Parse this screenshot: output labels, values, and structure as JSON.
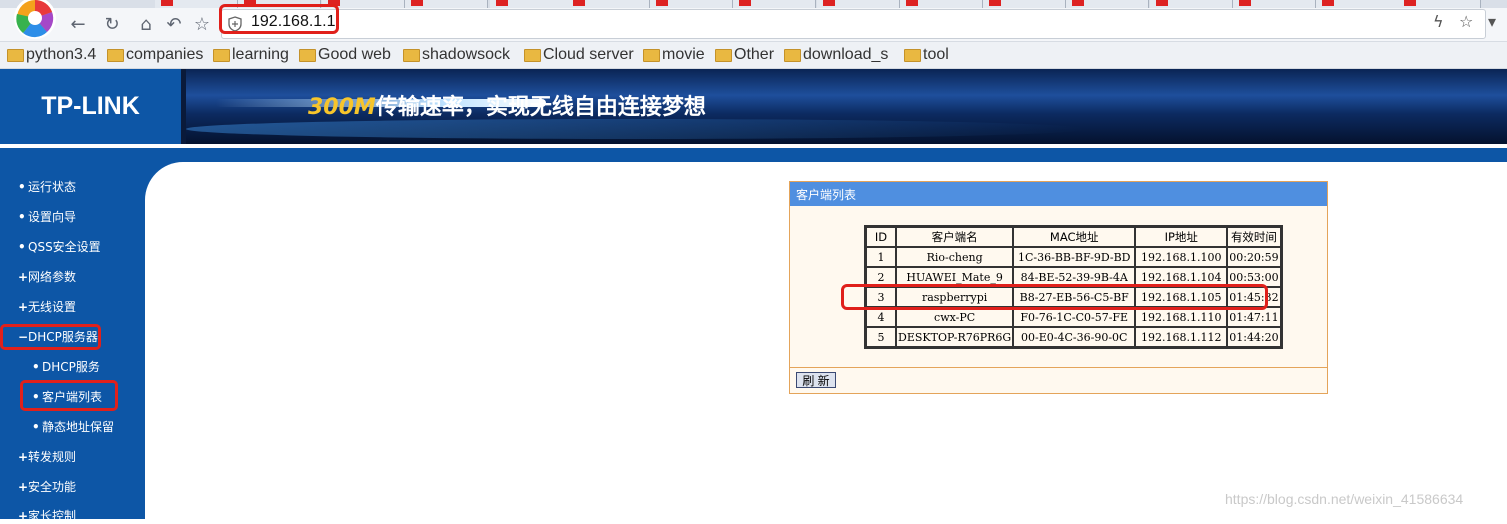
{
  "browser": {
    "address": "192.168.1.1",
    "bookmarks": [
      "python3.4",
      "companies",
      "learning",
      "Good web",
      "shadowsock",
      "Cloud server",
      "movie",
      "Other",
      "download_s",
      "tool"
    ]
  },
  "router": {
    "logo": "TP-LINK",
    "banner_speed": "300M",
    "banner_slogan": "传输速率，实现无线自由连接梦想",
    "menu": [
      {
        "marker": "•",
        "label": "运行状态"
      },
      {
        "marker": "•",
        "label": "设置向导"
      },
      {
        "marker": "•",
        "label": "QSS安全设置"
      },
      {
        "marker": "+",
        "label": "网络参数"
      },
      {
        "marker": "+",
        "label": "无线设置"
      },
      {
        "marker": "−",
        "label": "DHCP服务器"
      },
      {
        "marker": "•",
        "label": "DHCP服务"
      },
      {
        "marker": "•",
        "label": "客户端列表"
      },
      {
        "marker": "•",
        "label": "静态地址保留"
      },
      {
        "marker": "+",
        "label": "转发规则"
      },
      {
        "marker": "+",
        "label": "安全功能"
      },
      {
        "marker": "+",
        "label": "家长控制"
      }
    ],
    "panel_title": "客户端列表",
    "table": {
      "headers": [
        "ID",
        "客户端名",
        "MAC地址",
        "IP地址",
        "有效时间"
      ],
      "rows": [
        [
          "1",
          "Rio-cheng",
          "1C-36-BB-BF-9D-BD",
          "192.168.1.100",
          "00:20:59"
        ],
        [
          "2",
          "HUAWEI_Mate_9",
          "84-BE-52-39-9B-4A",
          "192.168.1.104",
          "00:53:00"
        ],
        [
          "3",
          "raspberrypi",
          "B8-27-EB-56-C5-BF",
          "192.168.1.105",
          "01:45:32"
        ],
        [
          "4",
          "cwx-PC",
          "F0-76-1C-C0-57-FE",
          "192.168.1.110",
          "01:47:11"
        ],
        [
          "5",
          "DESKTOP-R76PR6G",
          "00-E0-4C-36-90-0C",
          "192.168.1.112",
          "01:44:20"
        ]
      ]
    },
    "refresh_label": "刷 新"
  },
  "watermark": "https://blog.csdn.net/weixin_41586634",
  "colors": {
    "sidebar": "#0d56a6",
    "panel_title": "#4f8fe0",
    "highlight": "#e0201b"
  }
}
